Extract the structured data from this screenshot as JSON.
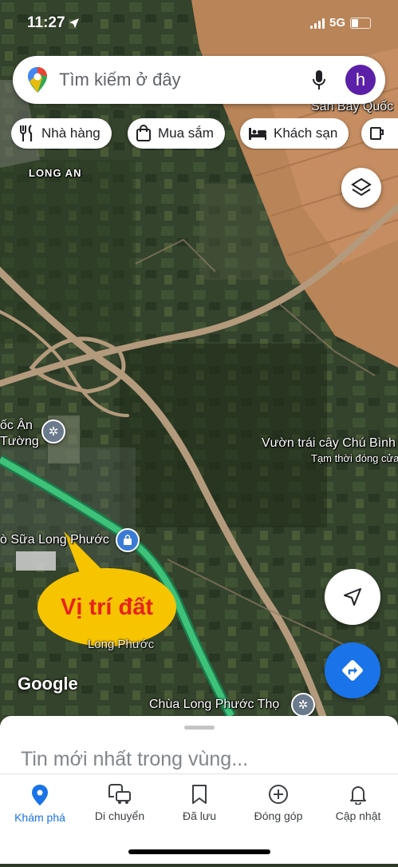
{
  "status_bar": {
    "time": "11:27",
    "network": "5G"
  },
  "search": {
    "placeholder": "Tìm kiếm ở đây",
    "avatar_letter": "h"
  },
  "chips": [
    "Nhà hàng",
    "Mua sắm",
    "Khách sạn"
  ],
  "map": {
    "labels": {
      "airport": "Sân Bay Quốc",
      "region": "LONG AN",
      "poi_left_1": "ốc Ân",
      "poi_left_2": "Tường",
      "orchard": "Vườn trái cây Chú Bình",
      "orchard_status": "Tạm thời đóng cửa",
      "dairy": "ò Sữa Long Phước",
      "long_phuoc": "Long Phước",
      "pagoda": "Chùa Long Phước Thọ"
    },
    "callout": "Vị trí đất",
    "logo": "Google"
  },
  "sheet": {
    "title": "Tin mới nhất trong vùng..."
  },
  "bottom_nav": [
    {
      "label": "Khám phá",
      "icon": "location-pin-icon",
      "active": true
    },
    {
      "label": "Di chuyển",
      "icon": "commute-icon",
      "active": false
    },
    {
      "label": "Đã lưu",
      "icon": "bookmark-icon",
      "active": false
    },
    {
      "label": "Đóng góp",
      "icon": "add-circle-icon",
      "active": false
    },
    {
      "label": "Cập nhật",
      "icon": "bell-icon",
      "active": false
    }
  ],
  "colors": {
    "accent": "#1a73e8",
    "avatar": "#5b1fa8",
    "callout_fill": "#f6c400",
    "callout_text": "#e8221b",
    "highway": "#3ec27a"
  }
}
